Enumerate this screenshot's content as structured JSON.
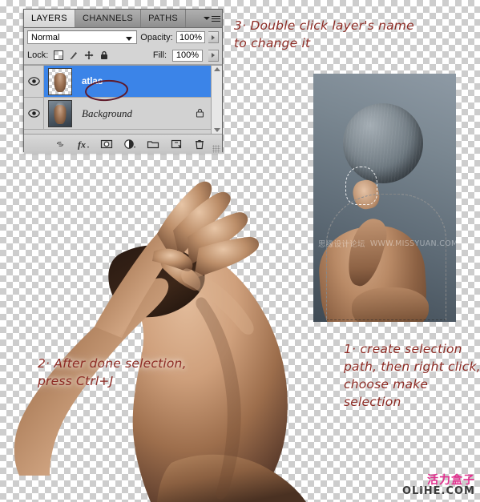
{
  "panel": {
    "tabs": [
      {
        "label": "LAYERS",
        "active": true
      },
      {
        "label": "CHANNELS",
        "active": false
      },
      {
        "label": "PATHS",
        "active": false
      }
    ],
    "menu_icon": "panel-menu-icon",
    "blend_mode": "Normal",
    "opacity_label": "Opacity:",
    "opacity_value": "100%",
    "lock_label": "Lock:",
    "lock_icons": [
      "lock-transparent-pixels-icon",
      "lock-image-pixels-icon",
      "lock-position-icon",
      "lock-all-icon"
    ],
    "fill_label": "Fill:",
    "fill_value": "100%",
    "layers": [
      {
        "name": "atlas",
        "selected": true,
        "visible": true,
        "locked": false
      },
      {
        "name": "Background",
        "selected": false,
        "visible": true,
        "locked": true
      }
    ],
    "bottom_icons": [
      "link-layers-icon",
      "layer-style-fx-icon",
      "add-layer-mask-icon",
      "new-adjustment-layer-icon",
      "new-group-folder-icon",
      "new-layer-icon",
      "delete-layer-trash-icon"
    ]
  },
  "annotations": {
    "step1": "1· create selection path, then right click, choose make selection",
    "step2": "2· After done selection, press Ctrl+J",
    "step3": "3· Double click layer's name to change it",
    "color": "#8d2b24"
  },
  "photo": {
    "watermark_cn": "思缘设计论坛",
    "watermark_en": "WWW.MISSYUAN.COM"
  },
  "site_watermark": {
    "cn": "活力盒子",
    "en": "OLiHE.COM",
    "cn_color": "#e3308f",
    "en_color": "#3b3b3b"
  },
  "colors": {
    "selection_blue": "#3b84e8",
    "panel_gray": "#d4d4d4",
    "circle_highlight": "#5e1a2a",
    "checkerboard_light": "#ffffff",
    "checkerboard_dark": "#cdcdcd"
  }
}
